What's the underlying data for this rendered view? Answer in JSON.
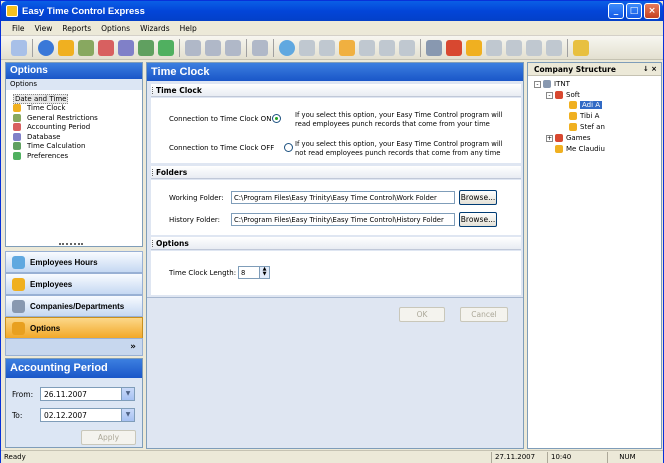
{
  "window": {
    "title": "Easy Time Control Express"
  },
  "menu": [
    "File",
    "View",
    "Reports",
    "Options",
    "Wizards",
    "Help"
  ],
  "left_panel": {
    "title": "Options",
    "subtitle": "Options",
    "items": [
      {
        "label": "Date and Time",
        "icon": "globe-icon",
        "selected": true
      },
      {
        "label": "Time Clock",
        "icon": "clock-icon"
      },
      {
        "label": "General Restrictions",
        "icon": "restriction-icon"
      },
      {
        "label": "Accounting Period",
        "icon": "period-icon"
      },
      {
        "label": "Database",
        "icon": "database-icon"
      },
      {
        "label": "Time Calculation",
        "icon": "calculator-icon"
      },
      {
        "label": "Preferences",
        "icon": "preferences-icon"
      }
    ]
  },
  "nav": [
    {
      "label": "Employees Hours",
      "icon": "employees-hours-icon"
    },
    {
      "label": "Employees",
      "icon": "employees-icon"
    },
    {
      "label": "Companies/Departments",
      "icon": "companies-icon"
    },
    {
      "label": "Options",
      "icon": "options-icon",
      "active": true
    }
  ],
  "nav_chevron": "»",
  "accounting": {
    "title": "Accounting Period",
    "from_label": "From:",
    "from_value": "26.11.2007",
    "to_label": "To:",
    "to_value": "02.12.2007",
    "apply_label": "Apply"
  },
  "main": {
    "title": "Time Clock",
    "section_timeclock": "Time Clock",
    "on_label": "Connection to Time Clock ON",
    "on_desc": "If you select this option, your Easy Time Control program will read employees punch records that come from your time",
    "off_label": "Connection to Time Clock OFF",
    "off_desc": "If you select this option, your Easy Time Control program will not read employees punch records that come from any time",
    "section_folders": "Folders",
    "working_label": "Working Folder:",
    "working_value": "C:\\Program Files\\Easy Trinity\\Easy Time Control\\Work Folder",
    "history_label": "History Folder:",
    "history_value": "C:\\Program Files\\Easy Trinity\\Easy Time Control\\History Folder",
    "browse_label": "Browse...",
    "section_options": "Options",
    "length_label": "Time Clock Length:",
    "length_value": "8",
    "ok_label": "OK",
    "cancel_label": "Cancel"
  },
  "company": {
    "title": "Company Structure",
    "pin": "↓ ×",
    "tree": [
      {
        "label": "ITNT",
        "level": 0,
        "expander": "-"
      },
      {
        "label": "Soft",
        "level": 1,
        "expander": "-"
      },
      {
        "label": "Adi A",
        "level": 2,
        "selected": true
      },
      {
        "label": "Tibi A",
        "level": 2
      },
      {
        "label": "Stef an",
        "level": 2
      },
      {
        "label": "Games",
        "level": 1,
        "expander": "+"
      },
      {
        "label": "Me Claudiu",
        "level": 1
      }
    ]
  },
  "status": {
    "text": "Ready",
    "date": "27.11.2007",
    "time": "10:40",
    "num": "NUM"
  }
}
